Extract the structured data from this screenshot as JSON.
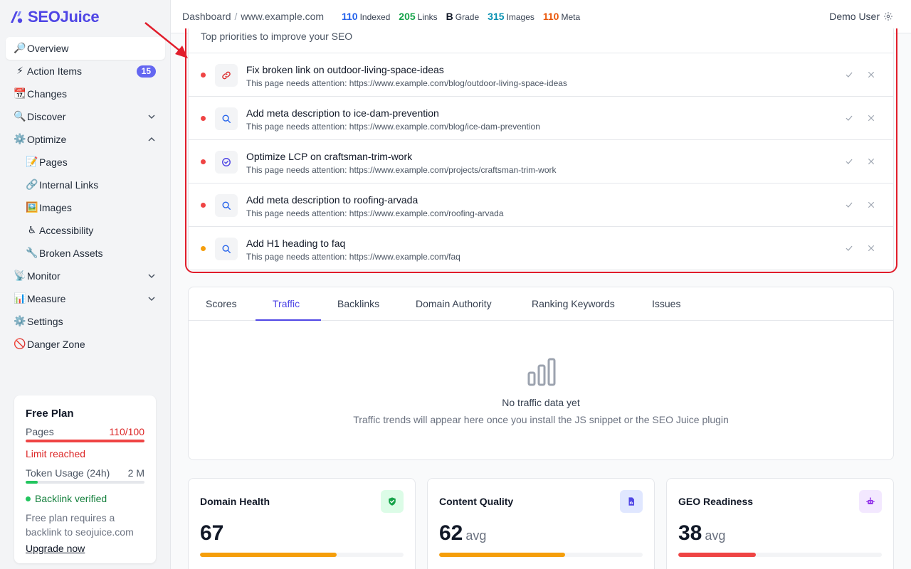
{
  "brand": {
    "name": "SEOJuice",
    "color": "#4f46e5"
  },
  "sidebar": {
    "items": [
      {
        "emoji": "🔎",
        "label": "Overview",
        "active": true
      },
      {
        "emoji": "⚡",
        "label": "Action Items",
        "badge": "15"
      },
      {
        "emoji": "📆",
        "label": "Changes"
      },
      {
        "emoji": "🔍",
        "label": "Discover",
        "chevron": "down"
      },
      {
        "emoji": "⚙️",
        "label": "Optimize",
        "chevron": "up"
      },
      {
        "emoji": "📝",
        "label": "Pages",
        "sub": true
      },
      {
        "emoji": "🔗",
        "label": "Internal Links",
        "sub": true
      },
      {
        "emoji": "🖼️",
        "label": "Images",
        "sub": true
      },
      {
        "emoji": "♿",
        "label": "Accessibility",
        "sub": true
      },
      {
        "emoji": "🔧",
        "label": "Broken Assets",
        "sub": true
      },
      {
        "emoji": "📡",
        "label": "Monitor",
        "chevron": "down"
      },
      {
        "emoji": "📊",
        "label": "Measure",
        "chevron": "down"
      },
      {
        "emoji": "⚙️",
        "label": "Settings"
      },
      {
        "emoji": "🚫",
        "label": "Danger Zone"
      }
    ]
  },
  "plan": {
    "title": "Free Plan",
    "pages_label": "Pages",
    "pages_value": "110/100",
    "pages_fraction": 1.0,
    "limit_text": "Limit reached",
    "token_label": "Token Usage (24h)",
    "token_value": "2 M",
    "token_fraction": 0.1,
    "backlink_status": "Backlink verified",
    "note": "Free plan requires a backlink to seojuice.com",
    "upgrade": "Upgrade now"
  },
  "header": {
    "breadcrumb": [
      "Dashboard",
      "www.example.com"
    ],
    "stats": [
      {
        "value": "110",
        "label": "Indexed",
        "color": "#2563eb"
      },
      {
        "value": "205",
        "label": "Links",
        "color": "#16a34a"
      },
      {
        "value": "B",
        "label": "Grade",
        "color": "#111827"
      },
      {
        "value": "315",
        "label": "Images",
        "color": "#0891b2"
      },
      {
        "value": "110",
        "label": "Meta",
        "color": "#ea580c"
      }
    ],
    "user": "Demo User"
  },
  "priorities": {
    "heading": "Top priorities to improve your SEO",
    "items": [
      {
        "title": "Fix broken link on outdoor-living-space-ideas",
        "detail": "This page needs attention: https://www.example.com/blog/outdoor-living-space-ideas",
        "severity": "#ef4444",
        "icon": "link-icon",
        "icon_color": "#dc2626"
      },
      {
        "title": "Add meta description to ice-dam-prevention",
        "detail": "This page needs attention: https://www.example.com/blog/ice-dam-prevention",
        "severity": "#ef4444",
        "icon": "search-icon",
        "icon_color": "#2563eb"
      },
      {
        "title": "Optimize LCP on craftsman-trim-work",
        "detail": "This page needs attention: https://www.example.com/projects/craftsman-trim-work",
        "severity": "#ef4444",
        "icon": "check-circle-icon",
        "icon_color": "#4f46e5"
      },
      {
        "title": "Add meta description to roofing-arvada",
        "detail": "This page needs attention: https://www.example.com/roofing-arvada",
        "severity": "#ef4444",
        "icon": "search-icon",
        "icon_color": "#2563eb"
      },
      {
        "title": "Add H1 heading to faq",
        "detail": "This page needs attention: https://www.example.com/faq",
        "severity": "#f59e0b",
        "icon": "search-icon",
        "icon_color": "#2563eb"
      }
    ]
  },
  "tabs": {
    "items": [
      "Scores",
      "Traffic",
      "Backlinks",
      "Domain Authority",
      "Ranking Keywords",
      "Issues"
    ],
    "active": "Traffic",
    "empty_title": "No traffic data yet",
    "empty_sub": "Traffic trends will appear here once you install the JS snippet or the SEO Juice plugin"
  },
  "metrics": [
    {
      "title": "Domain Health",
      "value": "67",
      "avg": "",
      "fraction": 0.67,
      "bar_color": "#f59e0b",
      "icon": "shield-check-icon",
      "icon_bg": "#dcfce7",
      "icon_color": "#16a34a"
    },
    {
      "title": "Content Quality",
      "value": "62",
      "avg": "avg",
      "fraction": 0.62,
      "bar_color": "#f59e0b",
      "icon": "document-icon",
      "icon_bg": "#e0e7ff",
      "icon_color": "#4f46e5"
    },
    {
      "title": "GEO Readiness",
      "value": "38",
      "avg": "avg",
      "fraction": 0.38,
      "bar_color": "#ef4444",
      "icon": "robot-icon",
      "icon_bg": "#f3e8ff",
      "icon_color": "#9333ea"
    }
  ]
}
